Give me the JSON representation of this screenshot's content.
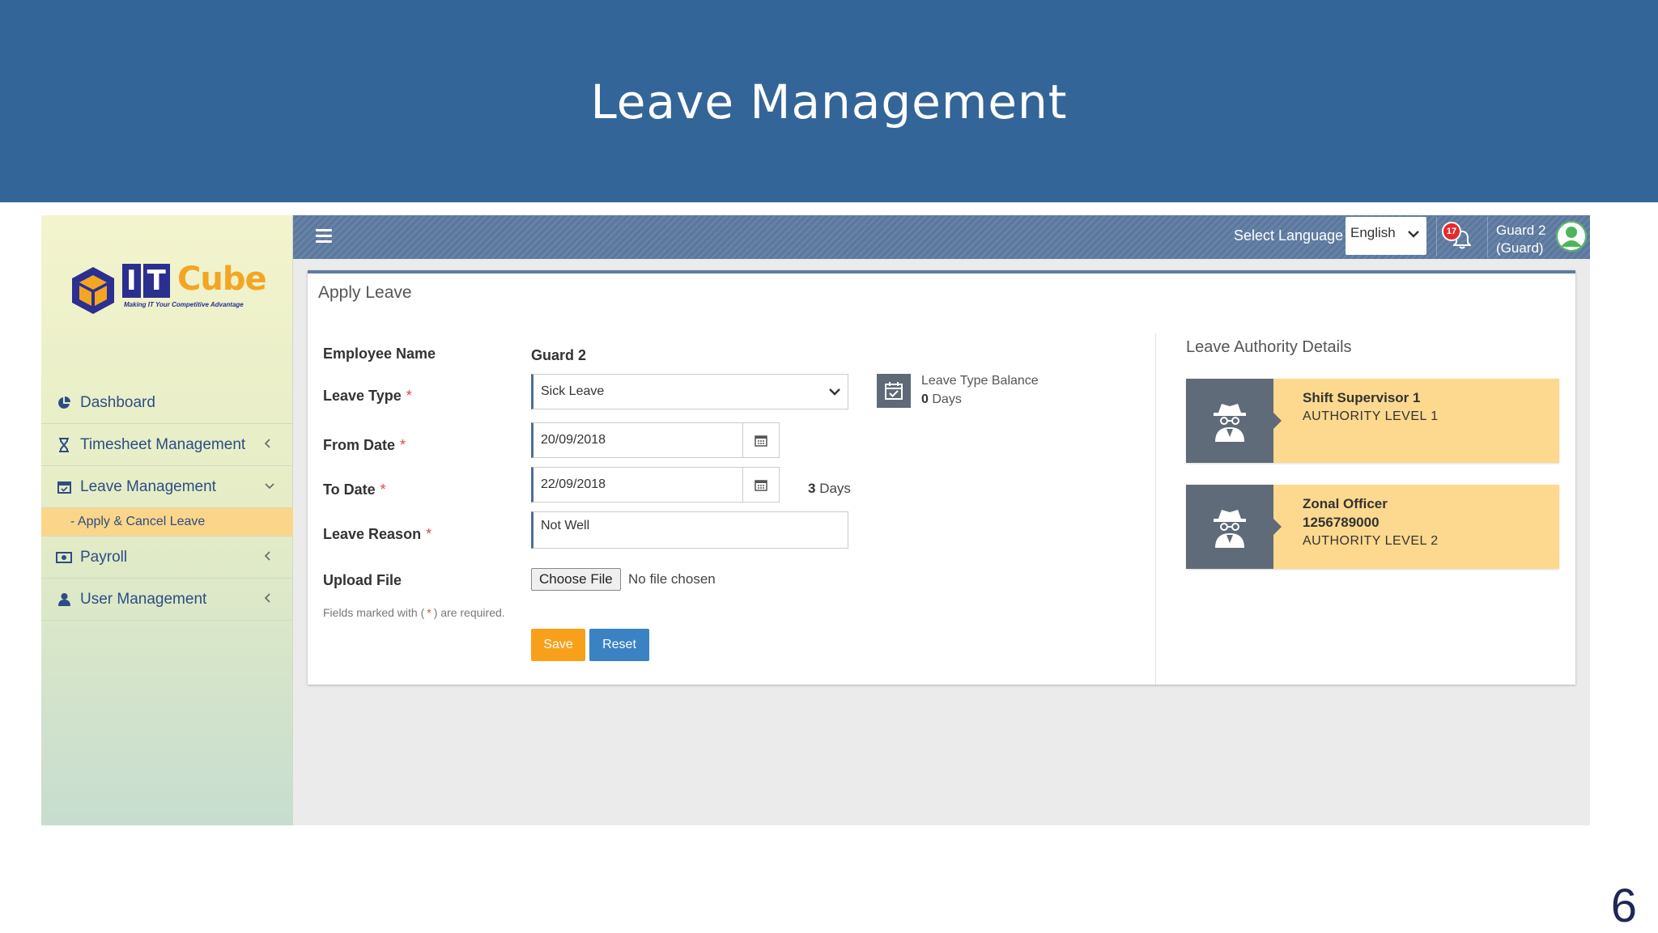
{
  "slide": {
    "title": "Leave Management",
    "page_number": "6"
  },
  "brand": {
    "logo_it": [
      "I",
      "T"
    ],
    "logo_cube": "Cube",
    "tagline": "Making IT Your Competitive Advantage"
  },
  "sidebar": {
    "items": [
      {
        "label": "Dashboard",
        "icon": "pie-chart-icon"
      },
      {
        "label": "Timesheet Management",
        "icon": "hourglass-icon"
      },
      {
        "label": "Leave Management",
        "icon": "calendar-icon"
      },
      {
        "label": "Payroll",
        "icon": "money-icon"
      },
      {
        "label": "User Management",
        "icon": "user-icon"
      }
    ],
    "active_sub_item": "- Apply & Cancel Leave"
  },
  "topbar": {
    "select_language_label": "Select Language",
    "language": "English",
    "notification_count": "17",
    "user_name": "Guard 2",
    "user_role": "(Guard)"
  },
  "form": {
    "title": "Apply Leave",
    "employee_name_label": "Employee Name",
    "employee_name": "Guard 2",
    "leave_type_label": "Leave Type",
    "leave_type": "Sick Leave",
    "balance_label": "Leave Type Balance",
    "balance_value": "0",
    "balance_unit": "Days",
    "from_date_label": "From Date",
    "from_date": "20/09/2018",
    "to_date_label": "To Date",
    "to_date": "22/09/2018",
    "days_count": "3",
    "days_unit": "Days",
    "leave_reason_label": "Leave Reason",
    "leave_reason": "Not Well",
    "upload_label": "Upload File",
    "choose_file": "Choose File",
    "no_file": "No file chosen",
    "note_before": "Fields marked with (",
    "note_star": "*",
    "note_after": ") are required.",
    "required_mark": "*",
    "save": "Save",
    "reset": "Reset"
  },
  "authority": {
    "title": "Leave Authority Details",
    "entries": [
      {
        "name": "Shift Supervisor 1",
        "id": "",
        "level": "AUTHORITY LEVEL 1"
      },
      {
        "name": "Zonal Officer",
        "id": "1256789000",
        "level": "AUTHORITY LEVEL 2"
      }
    ]
  },
  "colors": {
    "header_blue": "#346598",
    "topbar": "#5e7ba1",
    "save": "#f9a01b",
    "reset": "#3b82c4",
    "authority_card": "#fcd98e",
    "active_sub": "#fbd68a"
  }
}
